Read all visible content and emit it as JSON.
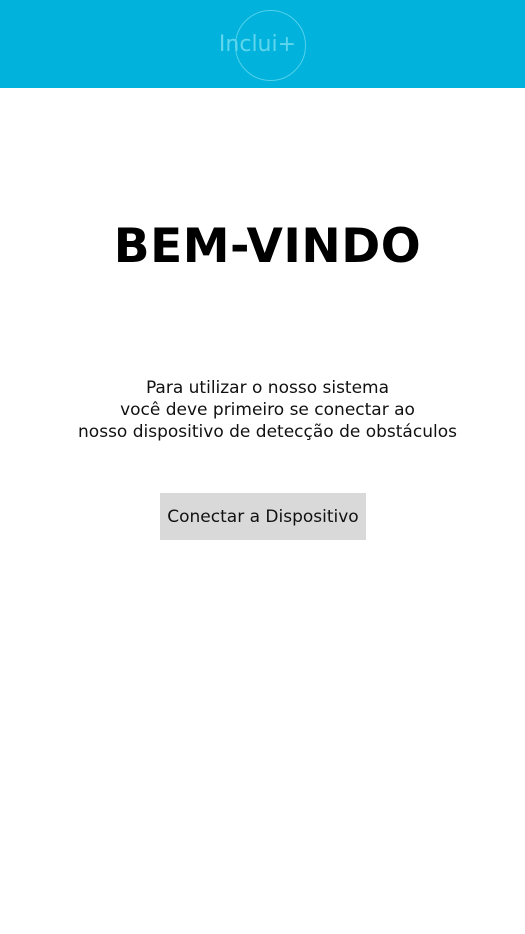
{
  "header": {
    "logo_text": "Inclui+",
    "background_color": "#00b2dc",
    "logo_color": "#5fd6ee"
  },
  "main": {
    "title": "BEM-VINDO",
    "instructions": [
      "Para utilizar o nosso sistema",
      "você deve primeiro se conectar ao",
      "nosso dispositivo de detecção de obstáculos"
    ],
    "connect_button_label": "Conectar a Dispositivo",
    "button_color": "#d9d9d9"
  }
}
